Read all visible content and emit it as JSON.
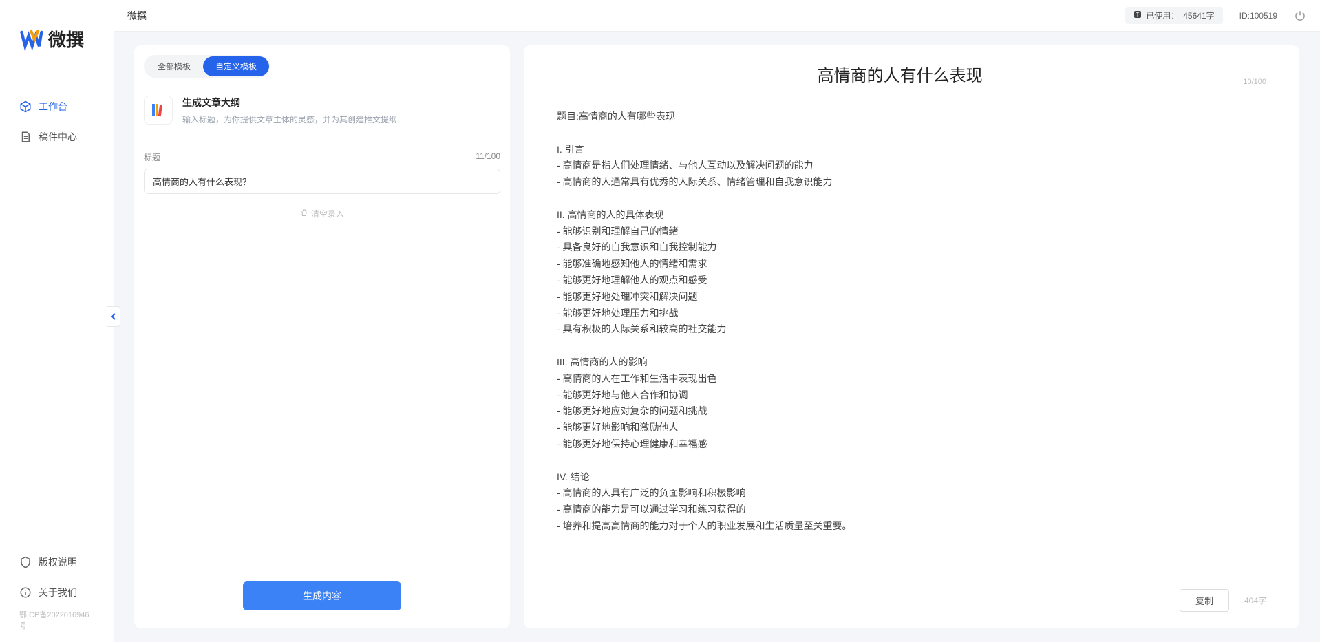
{
  "brand": {
    "name": "微撰"
  },
  "nav": {
    "workspace": "工作台",
    "drafts": "稿件中心",
    "license": "版权说明",
    "about": "关于我们",
    "icp": "鄂ICP备2022016946号"
  },
  "header": {
    "title": "微撰",
    "usage_label": "已使用：",
    "usage_value": "45641字",
    "uid_label": "ID:100519"
  },
  "tabs": {
    "all": "全部模板",
    "custom": "自定义模板"
  },
  "template": {
    "title": "生成文章大纲",
    "desc": "输入标题，为你提供文章主体的灵感，并为其创建推文提纲"
  },
  "field": {
    "label": "标题",
    "count": "11/100",
    "value": "高情商的人有什么表现？"
  },
  "clear": "清空录入",
  "generate": "生成内容",
  "result": {
    "title": "高情商的人有什么表现",
    "title_count": "10/100",
    "body": "题目:高情商的人有哪些表现\n\nI. 引言\n- 高情商是指人们处理情绪、与他人互动以及解决问题的能力\n- 高情商的人通常具有优秀的人际关系、情绪管理和自我意识能力\n\nII. 高情商的人的具体表现\n- 能够识别和理解自己的情绪\n- 具备良好的自我意识和自我控制能力\n- 能够准确地感知他人的情绪和需求\n- 能够更好地理解他人的观点和感受\n- 能够更好地处理冲突和解决问题\n- 能够更好地处理压力和挑战\n- 具有积极的人际关系和较高的社交能力\n\nIII. 高情商的人的影响\n- 高情商的人在工作和生活中表现出色\n- 能够更好地与他人合作和协调\n- 能够更好地应对复杂的问题和挑战\n- 能够更好地影响和激励他人\n- 能够更好地保持心理健康和幸福感\n\nIV. 结论\n- 高情商的人具有广泛的负面影响和积极影响\n- 高情商的能力是可以通过学习和练习获得的\n- 培养和提高高情商的能力对于个人的职业发展和生活质量至关重要。",
    "copy": "复制",
    "word_count": "404字"
  }
}
